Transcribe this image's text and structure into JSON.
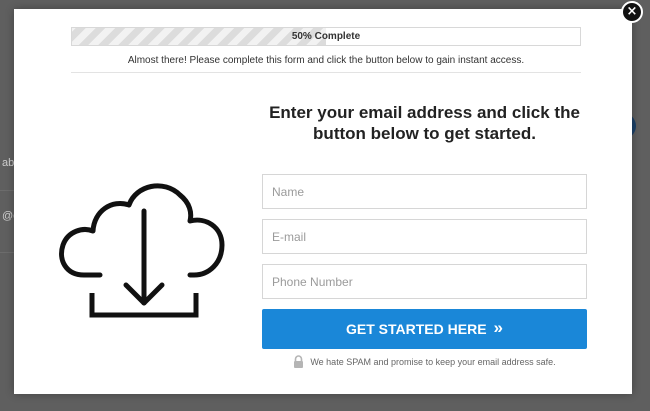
{
  "background": {
    "fragment_1": "abc",
    "fragment_2": "@c"
  },
  "modal": {
    "close_label": "×",
    "progress": {
      "label": "50% Complete",
      "percent": 50
    },
    "subtitle": "Almost there! Please complete this form and click the button below to gain instant access.",
    "headline": "Enter your email address and click the button below to get started.",
    "fields": {
      "name_placeholder": "Name",
      "email_placeholder": "E-mail",
      "phone_placeholder": "Phone Number"
    },
    "submit_label": "GET STARTED HERE",
    "submit_chevron": "»",
    "spam_note": "We hate SPAM and promise to keep your email address safe.",
    "icon": "cloud-download-icon",
    "colors": {
      "button": "#1a87d8",
      "overlay": "#5f5f5f"
    }
  }
}
